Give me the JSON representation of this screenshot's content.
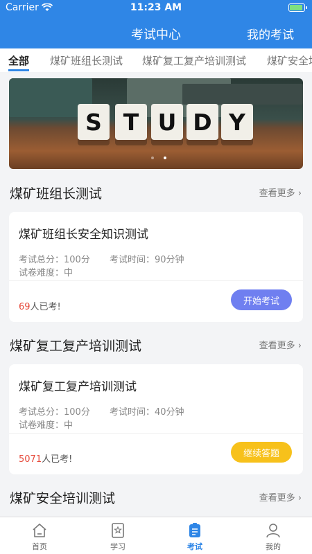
{
  "status": {
    "carrier": "Carrier",
    "time": "11:23 AM"
  },
  "nav": {
    "title": "考试中心",
    "right": "我的考试"
  },
  "tabs": [
    "全部",
    "煤矿班组长测试",
    "煤矿复工复产培训测试",
    "煤矿安全培"
  ],
  "banner": {
    "letters": [
      "S",
      "T",
      "U",
      "D",
      "Y"
    ]
  },
  "sections": [
    {
      "title": "煤矿班组长测试",
      "more": "查看更多",
      "card": {
        "title": "煤矿班组长安全知识测试",
        "score_label": "考试总分：",
        "score": "100分",
        "time_label": "考试时间：",
        "time": "90分钟",
        "difficulty_label": "试卷难度：",
        "difficulty": "中",
        "count": "69",
        "count_suffix": "人已考!",
        "button": "开始考试"
      }
    },
    {
      "title": "煤矿复工复产培训测试",
      "more": "查看更多",
      "card": {
        "title": "煤矿复工复产培训测试",
        "score_label": "考试总分：",
        "score": "100分",
        "time_label": "考试时间：",
        "time": "40分钟",
        "difficulty_label": "试卷难度：",
        "difficulty": "中",
        "count": "5071",
        "count_suffix": "人已考!",
        "button": "继续答题"
      }
    },
    {
      "title": "煤矿安全培训测试",
      "more": "查看更多"
    }
  ],
  "tabbar": [
    {
      "label": "首页",
      "icon": "home-icon"
    },
    {
      "label": "学习",
      "icon": "study-icon"
    },
    {
      "label": "考试",
      "icon": "exam-icon"
    },
    {
      "label": "我的",
      "icon": "profile-icon"
    }
  ],
  "colors": {
    "primary": "#2f86e6",
    "start_button": "#6f7ff0",
    "continue_button": "#f7c11b",
    "count": "#e64a3b"
  }
}
